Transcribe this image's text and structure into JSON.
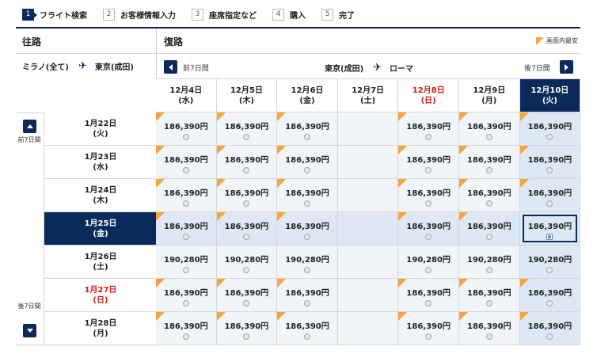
{
  "steps": [
    {
      "num": "1",
      "label": "フライト検索",
      "active": true
    },
    {
      "num": "2",
      "label": "お客様情報入力",
      "active": false
    },
    {
      "num": "3",
      "label": "座席指定など",
      "active": false
    },
    {
      "num": "4",
      "label": "購入",
      "active": false
    },
    {
      "num": "5",
      "label": "完了",
      "active": false
    }
  ],
  "outbound": {
    "title": "往路",
    "from": "ミラノ(全て)",
    "to": "東京(成田)"
  },
  "return": {
    "title": "復路",
    "from": "東京(成田)",
    "to": "ローマ",
    "prev_label": "前7日間",
    "next_label": "後7日間"
  },
  "legend": {
    "label": "画面内最安",
    "color": "#f7a43a"
  },
  "side": {
    "prev_label": "前7日間",
    "next_label": "後7日間"
  },
  "columns": [
    {
      "date": "12月4日",
      "dow": "(水)",
      "red": false,
      "selected": false
    },
    {
      "date": "12月5日",
      "dow": "(木)",
      "red": false,
      "selected": false
    },
    {
      "date": "12月6日",
      "dow": "(金)",
      "red": false,
      "selected": false
    },
    {
      "date": "12月7日",
      "dow": "(土)",
      "red": false,
      "selected": false
    },
    {
      "date": "12月8日",
      "dow": "(日)",
      "red": true,
      "selected": false
    },
    {
      "date": "12月9日",
      "dow": "(月)",
      "red": false,
      "selected": false
    },
    {
      "date": "12月10日",
      "dow": "(火)",
      "red": false,
      "selected": true
    }
  ],
  "rows": [
    {
      "date": "1月22日",
      "dow": "(火)",
      "red": false,
      "selected": false,
      "cells": [
        "186,390円",
        "186,390円",
        "186,390円",
        "",
        "186,390円",
        "186,390円",
        "186,390円"
      ]
    },
    {
      "date": "1月23日",
      "dow": "(水)",
      "red": false,
      "selected": false,
      "cells": [
        "186,390円",
        "186,390円",
        "186,390円",
        "",
        "186,390円",
        "186,390円",
        "186,390円"
      ]
    },
    {
      "date": "1月24日",
      "dow": "(木)",
      "red": false,
      "selected": false,
      "cells": [
        "186,390円",
        "186,390円",
        "186,390円",
        "",
        "186,390円",
        "186,390円",
        "186,390円"
      ]
    },
    {
      "date": "1月25日",
      "dow": "(金)",
      "red": false,
      "selected": true,
      "cells": [
        "186,390円",
        "186,390円",
        "186,390円",
        "",
        "186,390円",
        "186,390円",
        "186,390円"
      ]
    },
    {
      "date": "1月26日",
      "dow": "(土)",
      "red": false,
      "selected": false,
      "cells": [
        "190,280円",
        "190,280円",
        "190,280円",
        "",
        "190,280円",
        "190,280円",
        "190,280円"
      ]
    },
    {
      "date": "1月27日",
      "dow": "(日)",
      "red": true,
      "selected": false,
      "cells": [
        "186,390円",
        "186,390円",
        "186,390円",
        "",
        "186,390円",
        "186,390円",
        "186,390円"
      ]
    },
    {
      "date": "1月28日",
      "dow": "(月)",
      "red": false,
      "selected": false,
      "cells": [
        "186,390円",
        "186,390円",
        "186,390円",
        "",
        "186,390円",
        "186,390円",
        "186,390円"
      ]
    }
  ],
  "cheapest_flags": [
    [
      true,
      true,
      true,
      false,
      true,
      true,
      true
    ],
    [
      true,
      true,
      true,
      false,
      true,
      true,
      true
    ],
    [
      true,
      true,
      true,
      false,
      true,
      true,
      true
    ],
    [
      true,
      true,
      true,
      false,
      true,
      true,
      false
    ],
    [
      false,
      false,
      false,
      false,
      false,
      false,
      false
    ],
    [
      true,
      true,
      true,
      false,
      true,
      true,
      true
    ],
    [
      true,
      true,
      true,
      false,
      true,
      true,
      true
    ]
  ],
  "chosen_cell": {
    "row": 3,
    "col": 6
  }
}
